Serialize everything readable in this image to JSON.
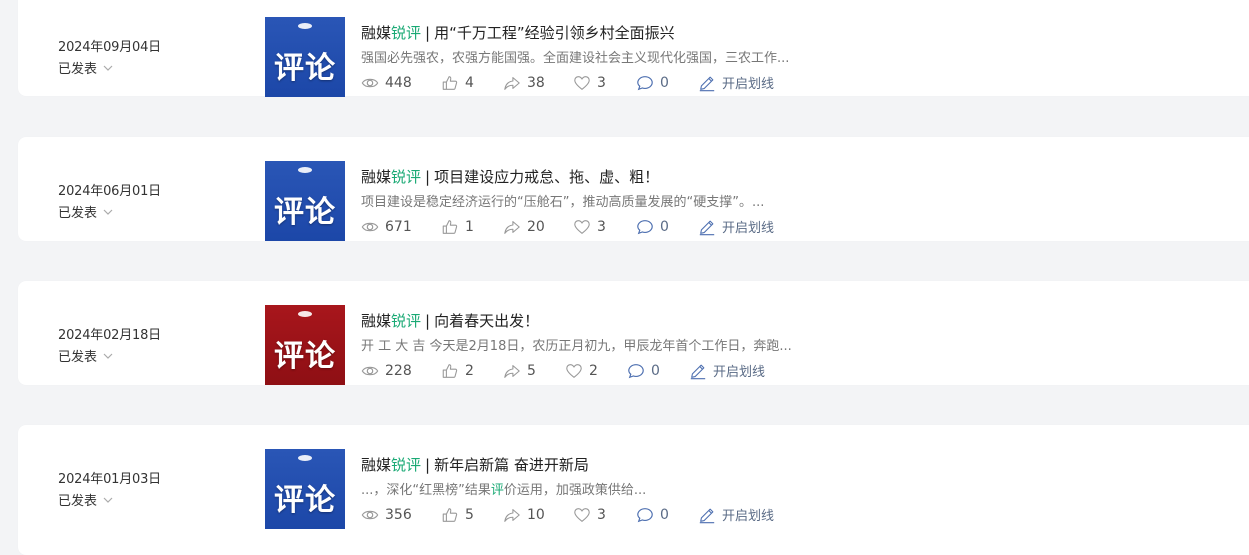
{
  "articles": [
    {
      "date": "2024年09月04日",
      "status": "已发表",
      "thumb_color": "blue",
      "thumb_text": "评论",
      "title_prefix": "融媒",
      "title_highlight": "锐评",
      "title_separator": "|",
      "title_main": "用“千万工程”经验引领乡村全面振兴",
      "summary_before": "强国必先强农，农强方能国强。全面建设社会主义现代化强国，三农工作...",
      "summary_highlight": "",
      "summary_after": "",
      "views": "448",
      "likes": "4",
      "shares": "38",
      "favorites": "3",
      "comments": "0",
      "mark_label": "开启划线"
    },
    {
      "date": "2024年06月01日",
      "status": "已发表",
      "thumb_color": "blue",
      "thumb_text": "评论",
      "title_prefix": "融媒",
      "title_highlight": "锐评",
      "title_separator": "|",
      "title_main": "项目建设应力戒怠、拖、虚、粗！",
      "summary_before": "项目建设是稳定经济运行的“压舱石”，推动高质量发展的“硬支撑”。...",
      "summary_highlight": "",
      "summary_after": "",
      "views": "671",
      "likes": "1",
      "shares": "20",
      "favorites": "3",
      "comments": "0",
      "mark_label": "开启划线"
    },
    {
      "date": "2024年02月18日",
      "status": "已发表",
      "thumb_color": "red",
      "thumb_text": "评论",
      "title_prefix": "融媒",
      "title_highlight": "锐评",
      "title_separator": "|",
      "title_main": "向着春天出发！",
      "summary_before": "开 工 大 吉 今天是2月18日，农历正月初九，甲辰龙年首个工作日，奔跑...",
      "summary_highlight": "",
      "summary_after": "",
      "views": "228",
      "likes": "2",
      "shares": "5",
      "favorites": "2",
      "comments": "0",
      "mark_label": "开启划线"
    },
    {
      "date": "2024年01月03日",
      "status": "已发表",
      "thumb_color": "blue",
      "thumb_text": "评论",
      "title_prefix": "融媒",
      "title_highlight": "锐评",
      "title_separator": "|",
      "title_main": "新年启新篇 奋进开新局",
      "summary_before": "...，深化“红黑榜”结果",
      "summary_highlight": "评",
      "summary_after": "价运用，加强政策供给...",
      "views": "356",
      "likes": "5",
      "shares": "10",
      "favorites": "3",
      "comments": "0",
      "mark_label": "开启划线"
    }
  ],
  "icons": {
    "views": "eye-icon",
    "likes": "thumbs-up-icon",
    "shares": "share-icon",
    "favorites": "heart-icon",
    "comments": "comment-icon",
    "mark": "pen-icon",
    "status": "chevron-down-icon"
  },
  "colors": {
    "highlight": "#19a974",
    "thumb_blue": "#1f4eb0",
    "thumb_red": "#9b1217",
    "page_bg": "#f3f4f6"
  }
}
